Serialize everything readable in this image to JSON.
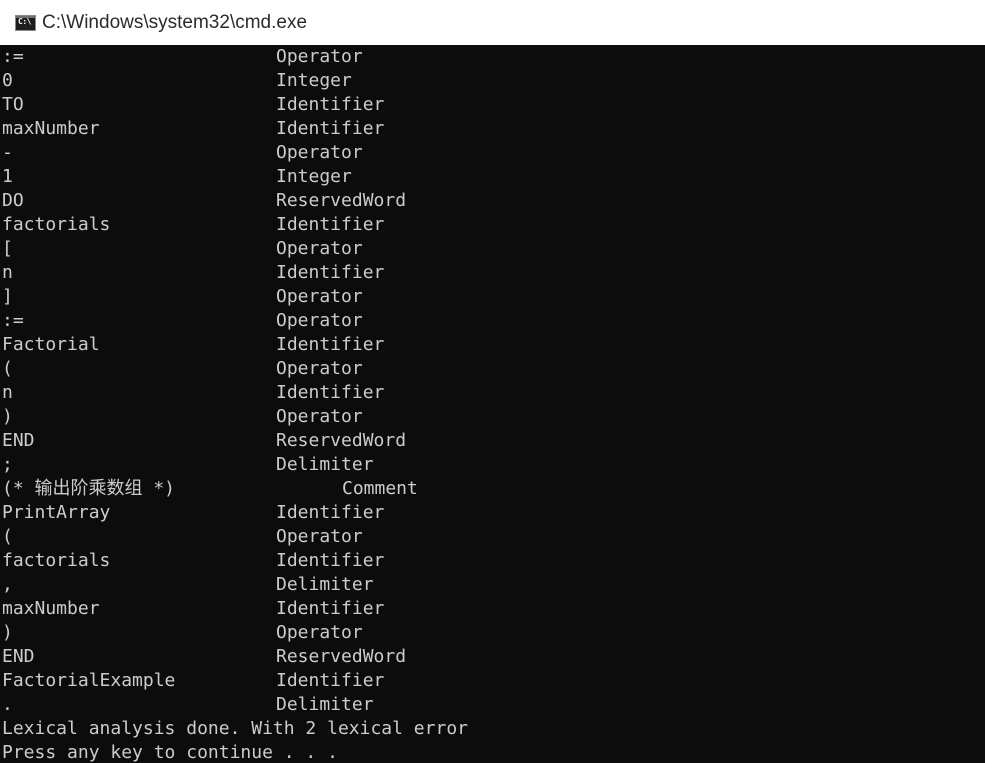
{
  "window": {
    "title": "C:\\Windows\\system32\\cmd.exe",
    "icon": "cmd-icon",
    "icon_glyph": "C:\\",
    "colors": {
      "background": "#0c0c0c",
      "text": "#cccccc",
      "titlebar": "#ffffff"
    }
  },
  "tokens": [
    {
      "lexeme": ":=",
      "type": "Operator"
    },
    {
      "lexeme": "0",
      "type": "Integer"
    },
    {
      "lexeme": "TO",
      "type": "Identifier"
    },
    {
      "lexeme": "maxNumber",
      "type": "Identifier"
    },
    {
      "lexeme": "-",
      "type": "Operator"
    },
    {
      "lexeme": "1",
      "type": "Integer"
    },
    {
      "lexeme": "DO",
      "type": "ReservedWord"
    },
    {
      "lexeme": "factorials",
      "type": "Identifier"
    },
    {
      "lexeme": "[",
      "type": "Operator"
    },
    {
      "lexeme": "n",
      "type": "Identifier"
    },
    {
      "lexeme": "]",
      "type": "Operator"
    },
    {
      "lexeme": ":=",
      "type": "Operator"
    },
    {
      "lexeme": "Factorial",
      "type": "Identifier"
    },
    {
      "lexeme": "(",
      "type": "Operator"
    },
    {
      "lexeme": "n",
      "type": "Identifier"
    },
    {
      "lexeme": ")",
      "type": "Operator"
    },
    {
      "lexeme": "END",
      "type": "ReservedWord"
    },
    {
      "lexeme": ";",
      "type": "Delimiter"
    },
    {
      "lexeme": "(* 输出阶乘数组 *)",
      "type": "Comment"
    },
    {
      "lexeme": "PrintArray",
      "type": "Identifier"
    },
    {
      "lexeme": "(",
      "type": "Operator"
    },
    {
      "lexeme": "factorials",
      "type": "Identifier"
    },
    {
      "lexeme": ",",
      "type": "Delimiter"
    },
    {
      "lexeme": "maxNumber",
      "type": "Identifier"
    },
    {
      "lexeme": ")",
      "type": "Operator"
    },
    {
      "lexeme": "END",
      "type": "ReservedWord"
    },
    {
      "lexeme": "FactorialExample",
      "type": "Identifier"
    },
    {
      "lexeme": ".",
      "type": "Delimiter"
    }
  ],
  "summary": "Lexical analysis done. With 2 lexical error",
  "prompt": "Press any key to continue . . ."
}
